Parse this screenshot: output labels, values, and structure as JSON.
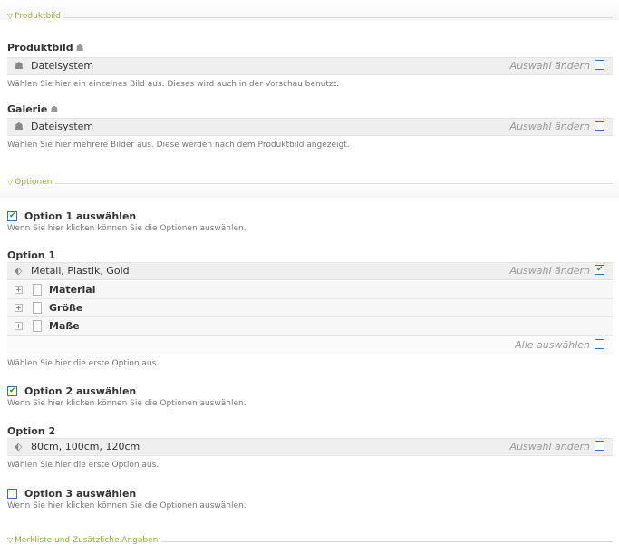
{
  "sections": {
    "produktbild": "Produktbild",
    "optionen": "Optionen",
    "merkliste": "Merkliste und Zusätzliche Angaben"
  },
  "produktbild": {
    "label": "Produktbild",
    "source": "Dateisystem",
    "change": "Auswahl ändern",
    "help": "Wählen Sie hier ein einzelnes Bild aus. Dieses wird auch in der Vorschau benutzt."
  },
  "galerie": {
    "label": "Galerie",
    "source": "Dateisystem",
    "change": "Auswahl ändern",
    "help": "Wählen Sie hier mehrere Bilder aus. Diese werden nach dem Produktbild angezeigt."
  },
  "option1_toggle": {
    "label": "Option 1 auswählen",
    "checked": true,
    "help": "Wenn Sie hier klicken können Sie die Optionen auswählen."
  },
  "option1": {
    "label": "Option 1",
    "values": "Metall, Plastik, Gold",
    "change": "Auswahl ändern",
    "change_checked": true,
    "tree": [
      "Material",
      "Größe",
      "Maße"
    ],
    "select_all": "Alle auswählen",
    "help": "Wählen Sie hier die erste Option aus."
  },
  "option2_toggle": {
    "label": "Option 2 auswählen",
    "checked": true,
    "help": "Wenn Sie hier klicken können Sie die Optionen auswählen."
  },
  "option2": {
    "label": "Option 2",
    "values": "80cm, 100cm, 120cm",
    "change": "Auswahl ändern",
    "help": "Wählen Sie hier die erste Option aus."
  },
  "option3_toggle": {
    "label": "Option 3 auswählen",
    "checked": false,
    "help": "Wenn Sie hier klicken können Sie die Optionen auswählen."
  },
  "colors": {
    "legend": "#8bb22f",
    "checkbox_border": "#3a6fa8",
    "check": "#2a8a2a"
  },
  "icons": {
    "legend_toggle": "triangle-down-icon",
    "camera": "camera-icon",
    "file_source": "filesystem-icon",
    "tag": "tag-icon",
    "tree_expand": "plus-icon",
    "page": "page-icon"
  }
}
